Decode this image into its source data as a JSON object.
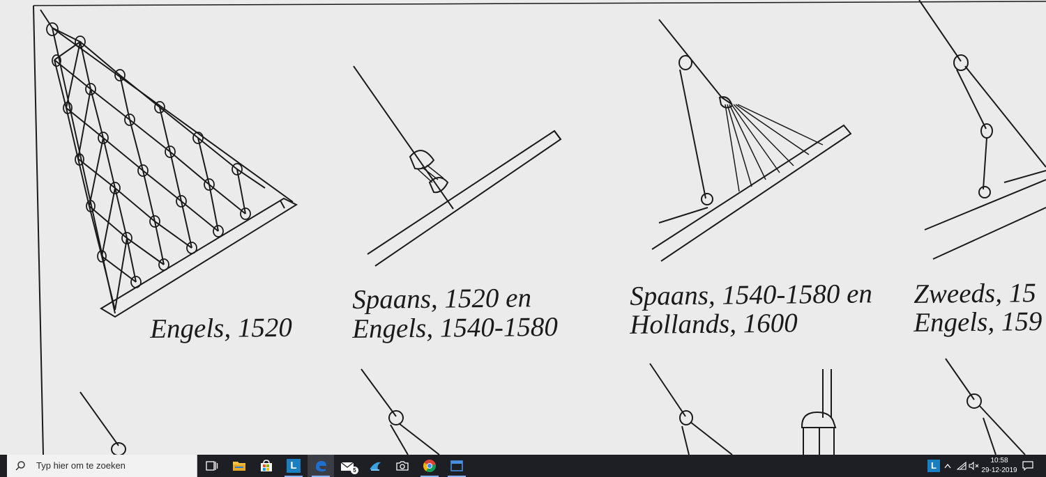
{
  "captions": {
    "engels": "Engels, 1520",
    "spaans_1520_line1": "Spaans, 1520 en",
    "spaans_1520_line2": "Engels, 1540-1580",
    "spaans_1540_line1": "Spaans, 1540-1580 en",
    "spaans_1540_line2": "Hollands, 1600",
    "zweeds_line1": "Zweeds, 15",
    "zweeds_line2": "Engels, 159"
  },
  "taskbar": {
    "search_placeholder": "Typ hier om te zoeken",
    "mail_badge": "5",
    "app_tile_letter": "L",
    "clock_time": "10:58",
    "clock_date": "29-12-2019"
  },
  "icons": {
    "search": "search-icon",
    "task_view": "task-view-icon",
    "explorer": "folder-icon",
    "store": "store-icon",
    "app": "app-tile-icon",
    "edge": "edge-icon",
    "mail": "mail-icon",
    "azure": "azure-icon",
    "camera": "camera-icon",
    "chrome": "chrome-icon",
    "window": "window-icon",
    "notification": "notification-icon"
  },
  "colors": {
    "taskbar_bg": "#1d1f24",
    "search_bg": "#f2f2f2",
    "app_tile": "#1a7fc1",
    "accent": "#8ab4f8"
  }
}
